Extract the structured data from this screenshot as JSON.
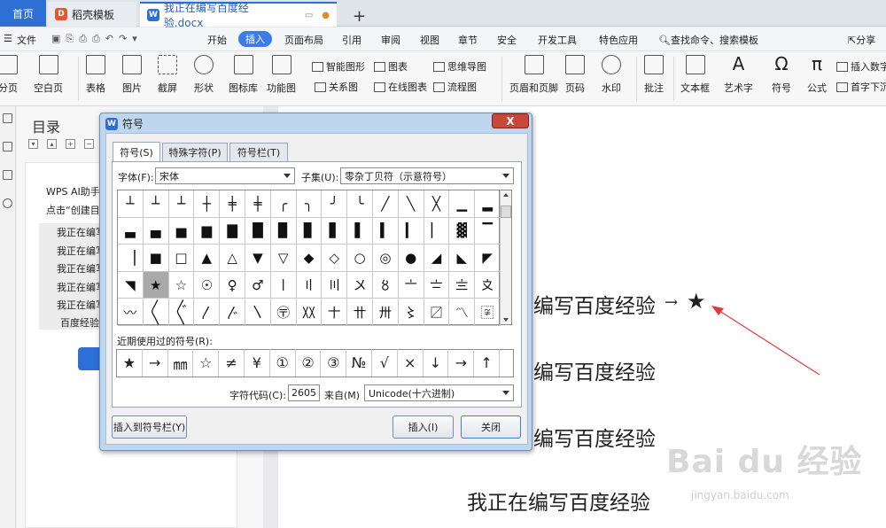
{
  "tabs": {
    "home": "首页",
    "template": "稻壳模板",
    "document": "我正在编写百度经验.docx",
    "add": "+"
  },
  "menu": {
    "file": "文件",
    "items": [
      "开始",
      "插入",
      "页面布局",
      "引用",
      "审阅",
      "视图",
      "章节",
      "安全",
      "开发工具",
      "特色应用"
    ],
    "search": "查找命令、搜索模板",
    "share": "分享"
  },
  "ribbon": {
    "big": [
      "分页",
      "空白页",
      "表格",
      "图片",
      "截屏",
      "形状",
      "图标库",
      "功能图",
      "页眉和页脚",
      "页码",
      "水印",
      "批注",
      "文本框",
      "艺术字",
      "符号",
      "公式"
    ],
    "small": {
      "smart_shape": "智能图形",
      "chart": "图表",
      "relation": "关系图",
      "online_chart": "在线图表",
      "mindmap": "思维导图",
      "flowchart": "流程图",
      "insert_number": "插入数字",
      "dropcap": "首字下沉"
    }
  },
  "toc": {
    "title": "目录",
    "ai_line1": "WPS AI助手",
    "ai_line2": "点击“创建目",
    "items": [
      "我正在编写",
      "我正在编写",
      "我正在编写",
      "我正在编写",
      "我正在编写",
      "百度经验"
    ]
  },
  "document": {
    "line1": "编写百度经验",
    "line2": "编写百度经验",
    "line3": "编写百度经验",
    "line4": "我正在编写百度经验",
    "arrow": "→",
    "star": "★"
  },
  "watermark": {
    "main": "Bai du 经验",
    "sub": "jingyan.baidu.com"
  },
  "dialog": {
    "title": "符号",
    "close": "X",
    "tabs": [
      "符号(S)",
      "特殊字符(P)",
      "符号栏(T)"
    ],
    "font_label": "字体(F):",
    "font_value": "宋体",
    "subset_label": "子集(U):",
    "subset_value": "零杂丁贝符（示意符号）",
    "grid": [
      [
        "┴",
        "┴",
        "┴",
        "┼",
        "╪",
        "╪",
        "╭",
        "╮",
        "╯",
        "╰",
        "╱",
        "╲",
        "╳",
        "▁",
        "▂"
      ],
      [
        "▃",
        "▄",
        "▅",
        "▆",
        "▇",
        "█",
        "▉",
        "▊",
        "▋",
        "▌",
        "▍",
        "▎",
        "▏",
        "▓",
        "▔"
      ],
      [
        "▕",
        "■",
        "□",
        "▲",
        "△",
        "▼",
        "▽",
        "◆",
        "◇",
        "○",
        "◎",
        "●",
        "◢",
        "◣",
        "◤"
      ],
      [
        "◥",
        "★",
        "☆",
        "☉",
        "♀",
        "♂",
        "〡",
        "〢",
        "〣",
        "〤",
        "〥",
        "〦",
        "〧",
        "〨",
        "〩"
      ],
      [
        "〰",
        "〱",
        "〲",
        "〳",
        "〴",
        "〵",
        "〶",
        "〷",
        "〸",
        "〹",
        "〺",
        "〻",
        "〼",
        "〽",
        "〾"
      ]
    ],
    "selected": "★",
    "recent_label": "近期使用过的符号(R):",
    "recent": [
      "★",
      "→",
      "㎜",
      "☆",
      "≠",
      "¥",
      "①",
      "②",
      "③",
      "№",
      "√",
      "×",
      "↓",
      "→",
      "↑"
    ],
    "code_label": "字符代码(C):",
    "code_value": "2605",
    "from_label": "来自(M)",
    "from_value": "Unicode(十六进制)",
    "btn_add_bar": "插入到符号栏(Y)",
    "btn_insert": "插入(I)",
    "btn_close": "关闭"
  }
}
